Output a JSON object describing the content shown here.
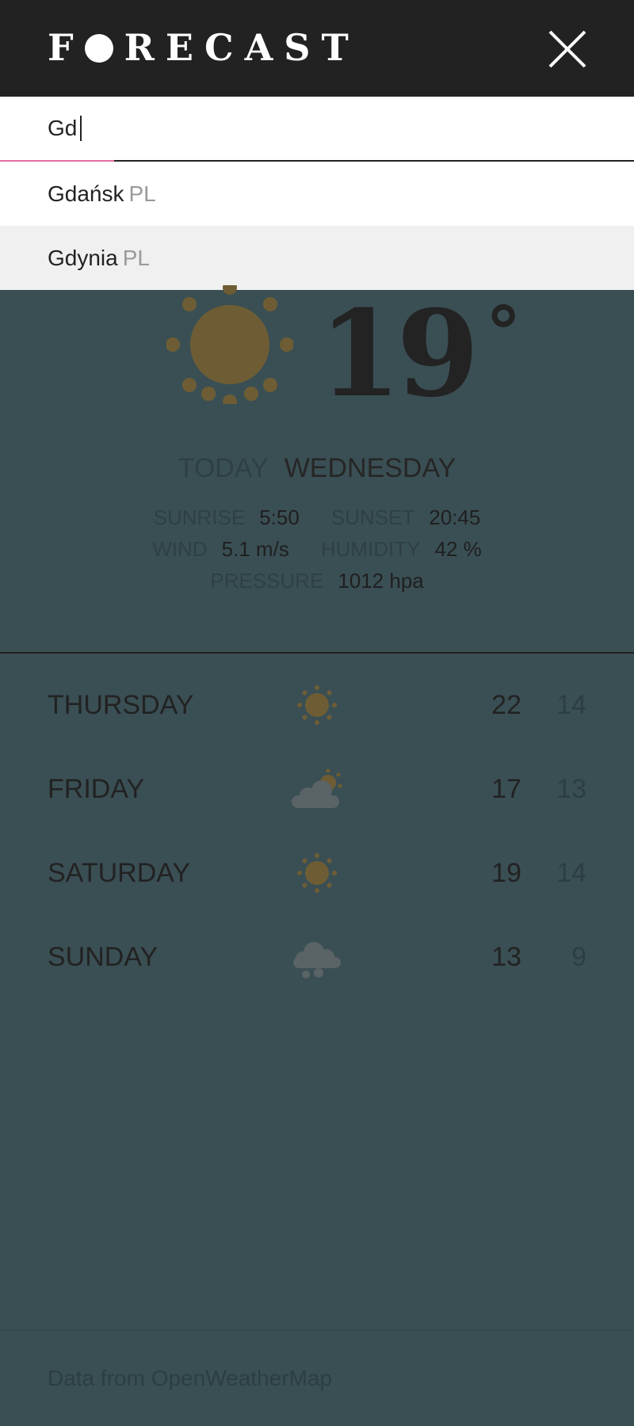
{
  "header": {
    "logo_letter_f": "F",
    "logo_rest": "RECAST",
    "close_icon": "close-icon"
  },
  "search": {
    "value": "Gd",
    "suggestions": [
      {
        "city": "Gdańsk",
        "country": "PL"
      },
      {
        "city": "Gdynia",
        "country": "PL"
      }
    ]
  },
  "current": {
    "icon": "sun-icon",
    "temperature": "19",
    "degree_symbol": "°",
    "today_label": "TODAY",
    "day": "WEDNESDAY",
    "sunrise_label": "SUNRISE",
    "sunrise": "5:50",
    "sunset_label": "SUNSET",
    "sunset": "20:45",
    "wind_label": "WIND",
    "wind": "5.1 m/s",
    "humidity_label": "HUMIDITY",
    "humidity": "42 %",
    "pressure_label": "PRESSURE",
    "pressure": "1012 hpa"
  },
  "forecast": [
    {
      "day": "THURSDAY",
      "icon": "sun-icon",
      "high": "22",
      "low": "14"
    },
    {
      "day": "FRIDAY",
      "icon": "partly-cloudy-icon",
      "high": "17",
      "low": "13"
    },
    {
      "day": "SATURDAY",
      "icon": "sun-icon",
      "high": "19",
      "low": "14"
    },
    {
      "day": "SUNDAY",
      "icon": "rain-cloud-icon",
      "high": "13",
      "low": "9"
    }
  ],
  "footer": {
    "text": "Data from OpenWeatherMap"
  },
  "colors": {
    "header_bg": "#222222",
    "page_bg": "#3a4f54",
    "accent_focus": "#e66ca3",
    "sun": "#6e5d34"
  }
}
